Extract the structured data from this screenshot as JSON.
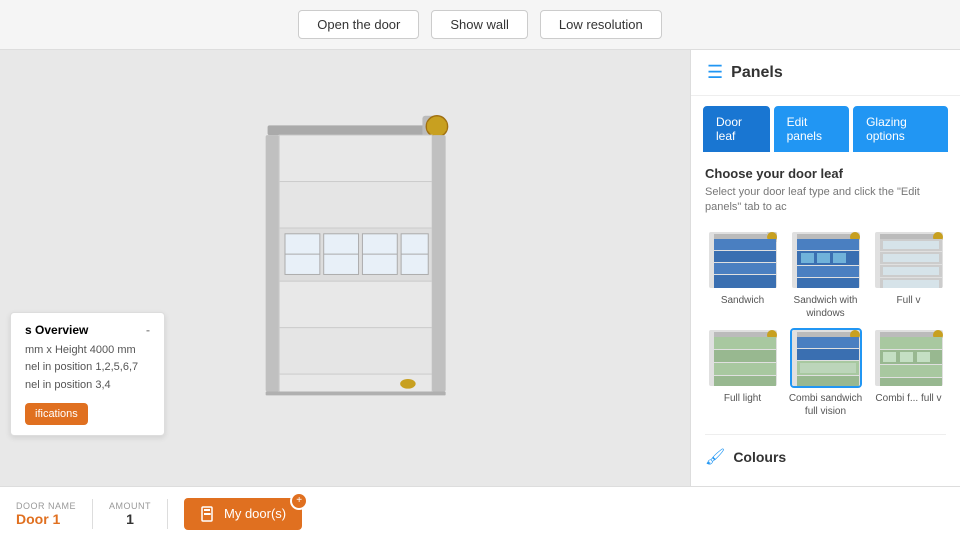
{
  "topBar": {
    "btn1": "Open the door",
    "btn2": "Show wall",
    "btn3": "Low resolution"
  },
  "infoPanel": {
    "title": "s Overview",
    "collapseBtn": "-",
    "line1": "mm x Height 4000 mm",
    "line2": "nel in position 1,2,5,6,7",
    "line3": "nel in position 3,4",
    "specBtn": "ifications"
  },
  "bottomBar": {
    "doorNameLabel": "DOOR NAME",
    "doorName": "Door 1",
    "amountLabel": "AMOUNT",
    "amount": "1",
    "myDoorsBtn": "My door(s)",
    "badge": "+"
  },
  "rightPanel": {
    "title": "Panels",
    "tabs": [
      {
        "label": "Door leaf",
        "active": true
      },
      {
        "label": "Edit panels",
        "active": false
      },
      {
        "label": "Glazing options",
        "active": false
      }
    ],
    "chooseDoorLeaf": {
      "title": "Choose your door leaf",
      "desc": "Select your door leaf type and click the \"Edit panels\" tab to ac"
    },
    "doorTypes": [
      {
        "id": "sandwich",
        "label": "Sandwich",
        "selected": false,
        "row": 1
      },
      {
        "id": "sandwich-windows",
        "label": "Sandwich with windows",
        "selected": false,
        "row": 1
      },
      {
        "id": "full-vision",
        "label": "Full v",
        "selected": false,
        "row": 1
      },
      {
        "id": "full-light",
        "label": "Full light",
        "selected": false,
        "row": 2
      },
      {
        "id": "combi-sandwich-full-vision",
        "label": "Combi sandwich full vision",
        "selected": true,
        "row": 2
      },
      {
        "id": "combi-full-vision-2",
        "label": "Combi f... full v",
        "selected": false,
        "row": 2
      }
    ],
    "coloursTitle": "Colours"
  }
}
